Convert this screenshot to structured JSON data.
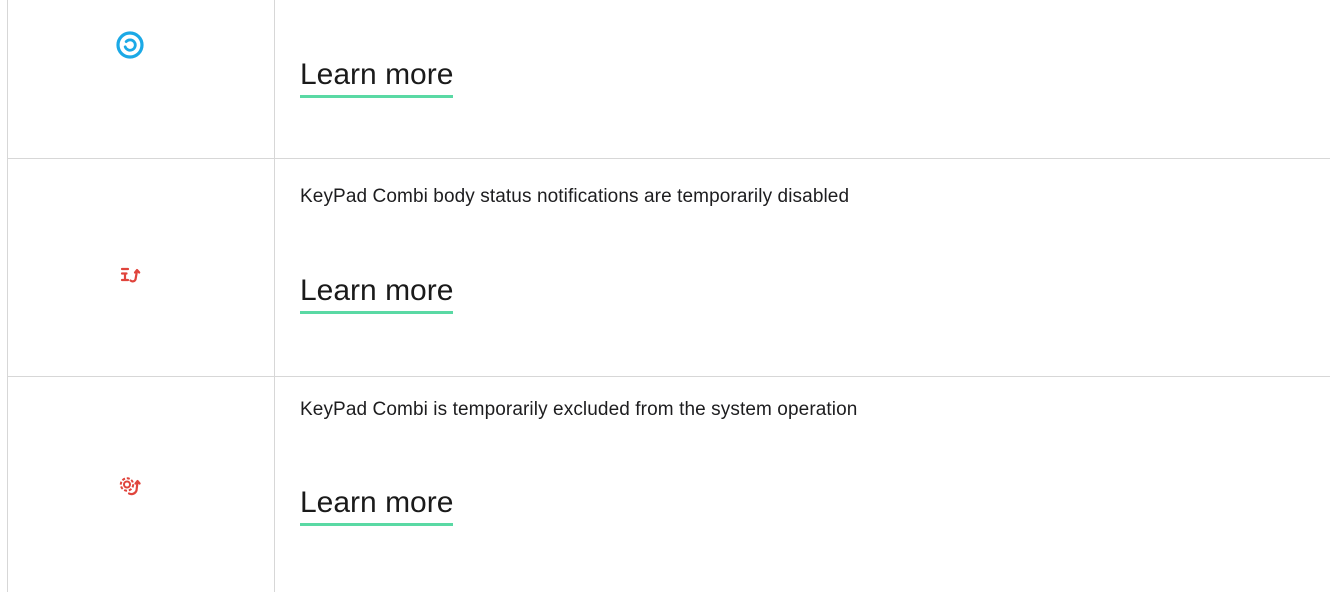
{
  "rows": [
    {
      "icon": "ring-status-icon",
      "icon_color": "#1ba9e6",
      "description": "",
      "link_label": "Learn more"
    },
    {
      "icon": "body-notifications-disabled-icon",
      "icon_color": "#e0443c",
      "description": "KeyPad Combi body status notifications are temporarily disabled",
      "link_label": "Learn more"
    },
    {
      "icon": "excluded-from-operation-icon",
      "icon_color": "#e0443c",
      "description": "KeyPad Combi is temporarily excluded from the system operation",
      "link_label": "Learn more"
    }
  ],
  "colors": {
    "link_underline": "#5ad9a4",
    "table_border": "#d7d7d7",
    "text": "#1d1d1f"
  }
}
